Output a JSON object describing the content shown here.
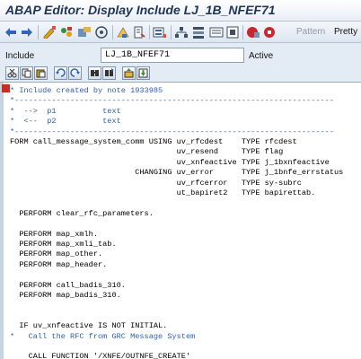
{
  "window": {
    "title": "ABAP Editor: Display Include LJ_1B_NFEF71"
  },
  "toolbar": {
    "icons": [
      "back-arrow-icon",
      "forward-arrow-icon",
      "toggle-display-change-icon",
      "other-object-icon",
      "activate-icon",
      "check-icon",
      "where-used-icon",
      "object-list-icon",
      "display-object-list-icon",
      "navigation-window-icon",
      "hierarchy-icon",
      "print-icon",
      "stop-icon",
      "breakpoint-icon",
      "session-breakpoint-icon",
      "external-breakpoint-icon"
    ],
    "pattern_label": "Pattern",
    "pretty_label": "Pretty"
  },
  "include_field": {
    "label": "Include",
    "value": "LJ_1B_NFEF71",
    "status": "Active"
  },
  "editor_buttons": [
    "cut-icon",
    "copy-icon",
    "paste-icon",
    "undo-icon",
    "redo-icon",
    "find-icon",
    "find-next-icon",
    "upload-icon",
    "download-icon"
  ],
  "code_lines": [
    {
      "text": "* Include created by note 1933985",
      "comment": true
    },
    {
      "text": "*---------------------------------------------------------------------",
      "comment": true
    },
    {
      "text": "*  -->  p1          text",
      "comment": true
    },
    {
      "text": "*  <--  p2          text",
      "comment": true
    },
    {
      "text": "*---------------------------------------------------------------------",
      "comment": true
    },
    {
      "text": "FORM call_message_system_comm USING uv_rfcdest    TYPE rfcdest",
      "comment": false
    },
    {
      "text": "                                    uv_resend     TYPE flag",
      "comment": false
    },
    {
      "text": "                                    uv_xnfeactive TYPE j_1bxnfeactive",
      "comment": false
    },
    {
      "text": "                           CHANGING uv_error      TYPE j_1bnfe_errstatus",
      "comment": false
    },
    {
      "text": "                                    uv_rfcerror   TYPE sy-subrc",
      "comment": false
    },
    {
      "text": "                                    ut_bapiret2   TYPE bapirettab.",
      "comment": false
    },
    {
      "text": "",
      "comment": false
    },
    {
      "text": "  PERFORM clear_rfc_parameters.",
      "comment": false
    },
    {
      "text": "",
      "comment": false
    },
    {
      "text": "  PERFORM map_xmlh.",
      "comment": false
    },
    {
      "text": "  PERFORM map_xmli_tab.",
      "comment": false
    },
    {
      "text": "  PERFORM map_other.",
      "comment": false
    },
    {
      "text": "  PERFORM map_header.",
      "comment": false
    },
    {
      "text": "",
      "comment": false
    },
    {
      "text": "  PERFORM call_badis_310.",
      "comment": false
    },
    {
      "text": "  PERFORM map_badis_310.",
      "comment": false
    },
    {
      "text": "",
      "comment": false
    },
    {
      "text": "",
      "comment": false
    },
    {
      "text": "  IF uv_xnfeactive IS NOT INITIAL.",
      "comment": false
    },
    {
      "text": "*   Call the RFC from GRC Message System",
      "comment": true
    },
    {
      "text": "",
      "comment": false
    },
    {
      "text": "    CALL FUNCTION '/XNFE/OUTNFE_CREATE'",
      "comment": false
    }
  ]
}
